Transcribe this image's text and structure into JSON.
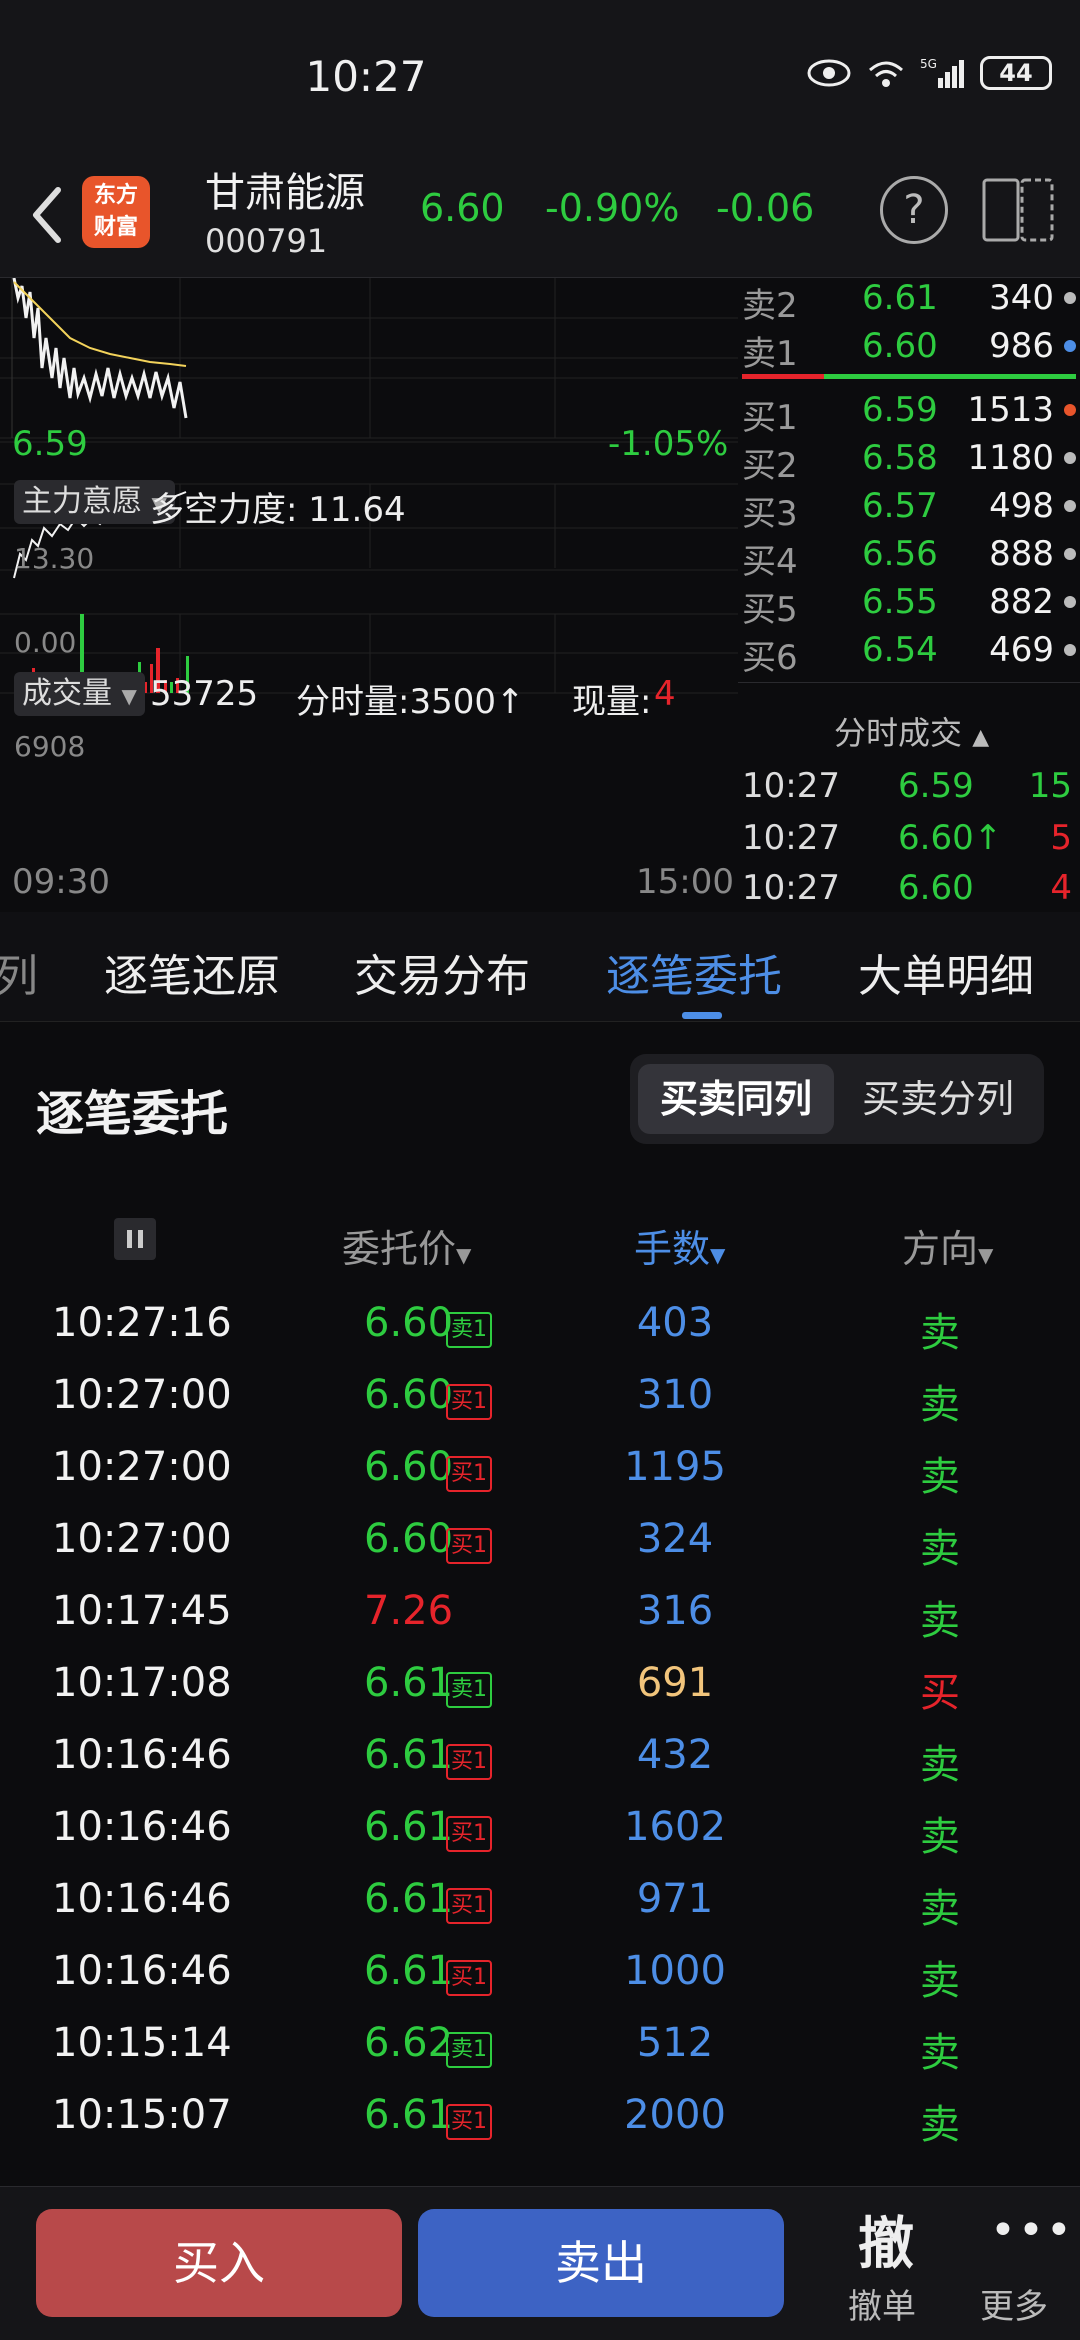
{
  "status_bar": {
    "time": "10:27",
    "battery": "44"
  },
  "header": {
    "logo": [
      "东方",
      "财富"
    ],
    "stock_name": "甘肃能源",
    "stock_code": "000791",
    "price": "6.60",
    "pct_change": "-0.90%",
    "change": "-0.06"
  },
  "chart": {
    "price_low_label": "6.59",
    "pct_low_label": "-1.05%",
    "indicator_tag": "主力意愿",
    "indicator_text": "多空力度: 11.64",
    "indicator_max": "13.30",
    "indicator_min": "0.00",
    "volume_tag": "成交量",
    "volume_value": "53725",
    "volume_intraday": "分时量:3500↑",
    "volume_now_label": "现量:",
    "volume_now_value": "4",
    "volume_max": "6908",
    "time_start": "09:30",
    "time_end": "15:00"
  },
  "order_book": {
    "asks": [
      {
        "label": "卖2",
        "price": "6.61",
        "volume": "340"
      },
      {
        "label": "卖1",
        "price": "6.60",
        "volume": "986"
      }
    ],
    "bids": [
      {
        "label": "买1",
        "price": "6.59",
        "volume": "1513"
      },
      {
        "label": "买2",
        "price": "6.58",
        "volume": "1180"
      },
      {
        "label": "买3",
        "price": "6.57",
        "volume": "498"
      },
      {
        "label": "买4",
        "price": "6.56",
        "volume": "888"
      },
      {
        "label": "买5",
        "price": "6.55",
        "volume": "882"
      },
      {
        "label": "买6",
        "price": "6.54",
        "volume": "469"
      }
    ],
    "ticks_title": "分时成交",
    "ticks": [
      {
        "time": "10:27",
        "price": "6.59",
        "volume": "15"
      },
      {
        "time": "10:27",
        "price": "6.60↑",
        "volume": "5"
      },
      {
        "time": "10:27",
        "price": "6.60",
        "volume": "4"
      }
    ]
  },
  "tabs": [
    "列",
    "逐笔还原",
    "交易分布",
    "逐笔委托",
    "大单明细"
  ],
  "section": {
    "title": "逐笔委托",
    "seg_same": "买卖同列",
    "seg_split": "买卖分列"
  },
  "columns": {
    "price": "委托价",
    "qty": "手数",
    "direction": "方向"
  },
  "trades": [
    {
      "time": "10:27:16",
      "price": "6.60",
      "badge": "卖1",
      "qty": "403",
      "dir": "卖"
    },
    {
      "time": "10:27:00",
      "price": "6.60",
      "badge": "买1",
      "qty": "310",
      "dir": "卖"
    },
    {
      "time": "10:27:00",
      "price": "6.60",
      "badge": "买1",
      "qty": "1195",
      "dir": "卖"
    },
    {
      "time": "10:27:00",
      "price": "6.60",
      "badge": "买1",
      "qty": "324",
      "dir": "卖"
    },
    {
      "time": "10:17:45",
      "price": "7.26",
      "badge": "",
      "qty": "316",
      "dir": "卖"
    },
    {
      "time": "10:17:08",
      "price": "6.61",
      "badge": "卖1",
      "qty": "691",
      "dir": "买"
    },
    {
      "time": "10:16:46",
      "price": "6.61",
      "badge": "买1",
      "qty": "432",
      "dir": "卖"
    },
    {
      "time": "10:16:46",
      "price": "6.61",
      "badge": "买1",
      "qty": "1602",
      "dir": "卖"
    },
    {
      "time": "10:16:46",
      "price": "6.61",
      "badge": "买1",
      "qty": "971",
      "dir": "卖"
    },
    {
      "time": "10:16:46",
      "price": "6.61",
      "badge": "买1",
      "qty": "1000",
      "dir": "卖"
    },
    {
      "time": "10:15:14",
      "price": "6.62",
      "badge": "卖1",
      "qty": "512",
      "dir": "卖"
    },
    {
      "time": "10:15:07",
      "price": "6.61",
      "badge": "买1",
      "qty": "2000",
      "dir": "卖"
    }
  ],
  "bottom": {
    "buy": "买入",
    "sell": "卖出",
    "cancel_icon": "撤",
    "cancel": "撤单",
    "more": "更多"
  },
  "colors": {
    "up": "#e6242b",
    "down": "#2ecc40",
    "accent": "#4d8ee6",
    "buy_button": "#b8494a",
    "sell_button": "#3d63c4",
    "qty_highlight": "#f2c57c"
  }
}
